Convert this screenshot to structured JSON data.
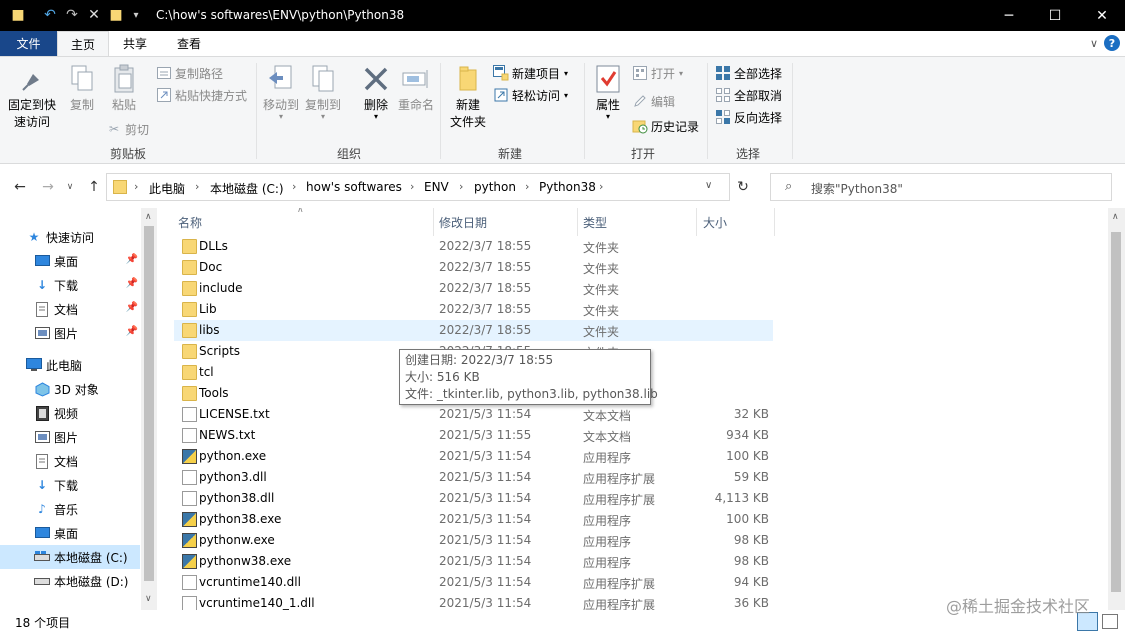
{
  "window": {
    "title": "C:\\how's softwares\\ENV\\python\\Python38",
    "minimize": "─",
    "maximize": "☐",
    "close": "✕"
  },
  "ribbon_tabs": [
    "文件",
    "主页",
    "共享",
    "查看"
  ],
  "ribbon": {
    "clipboard": {
      "label": "剪贴板",
      "pin": "固定到快\n速访问",
      "pin_line1": "固定到快",
      "pin_line2": "速访问",
      "copy": "复制",
      "paste": "粘贴",
      "copy_path": "复制路径",
      "paste_shortcut": "粘贴快捷方式",
      "cut": "剪切"
    },
    "organize": {
      "label": "组织",
      "move_to": "移动到",
      "copy_to": "复制到",
      "delete": "删除",
      "rename": "重命名"
    },
    "new": {
      "label": "新建",
      "new_folder_line1": "新建",
      "new_folder_line2": "文件夹",
      "new_item": "新建项目",
      "easy_access": "轻松访问"
    },
    "open": {
      "label": "打开",
      "properties": "属性",
      "open": "打开",
      "edit": "编辑",
      "history": "历史记录"
    },
    "select": {
      "label": "选择",
      "select_all": "全部选择",
      "select_none": "全部取消",
      "invert": "反向选择"
    }
  },
  "address": {
    "crumbs": [
      "此电脑",
      "本地磁盘 (C:)",
      "how's softwares",
      "ENV",
      "python",
      "Python38"
    ],
    "search_placeholder": "搜索\"Python38\""
  },
  "nav": [
    {
      "label": "快速访问",
      "icon": "star-icon",
      "pinned": false
    },
    {
      "label": "桌面",
      "icon": "desktop-icon",
      "pinned": true
    },
    {
      "label": "下载",
      "icon": "download-icon",
      "pinned": true
    },
    {
      "label": "文档",
      "icon": "document-icon",
      "pinned": true
    },
    {
      "label": "图片",
      "icon": "pictures-icon",
      "pinned": true
    },
    {
      "label": "此电脑",
      "icon": "computer-icon",
      "pinned": false
    },
    {
      "label": "3D 对象",
      "icon": "3d-objects-icon",
      "pinned": false
    },
    {
      "label": "视频",
      "icon": "video-icon",
      "pinned": false
    },
    {
      "label": "图片",
      "icon": "pictures-icon",
      "pinned": false
    },
    {
      "label": "文档",
      "icon": "document-icon",
      "pinned": false
    },
    {
      "label": "下载",
      "icon": "download-icon",
      "pinned": false
    },
    {
      "label": "音乐",
      "icon": "music-icon",
      "pinned": false
    },
    {
      "label": "桌面",
      "icon": "desktop-icon",
      "pinned": false
    },
    {
      "label": "本地磁盘 (C:)",
      "icon": "drive-icon",
      "pinned": false,
      "selected": true
    },
    {
      "label": "本地磁盘 (D:)",
      "icon": "drive-icon",
      "pinned": false
    }
  ],
  "columns": {
    "name": "名称",
    "date": "修改日期",
    "type": "类型",
    "size": "大小"
  },
  "files": [
    {
      "name": "DLLs",
      "date": "2022/3/7 18:55",
      "type": "文件夹",
      "size": "",
      "kind": "folder"
    },
    {
      "name": "Doc",
      "date": "2022/3/7 18:55",
      "type": "文件夹",
      "size": "",
      "kind": "folder"
    },
    {
      "name": "include",
      "date": "2022/3/7 18:55",
      "type": "文件夹",
      "size": "",
      "kind": "folder"
    },
    {
      "name": "Lib",
      "date": "2022/3/7 18:55",
      "type": "文件夹",
      "size": "",
      "kind": "folder"
    },
    {
      "name": "libs",
      "date": "2022/3/7 18:55",
      "type": "文件夹",
      "size": "",
      "kind": "folder",
      "hover": true
    },
    {
      "name": "Scripts",
      "date": "2022/3/7 18:55",
      "type": "文件夹",
      "size": "",
      "kind": "folder"
    },
    {
      "name": "tcl",
      "date": "",
      "type": "",
      "size": "",
      "kind": "folder"
    },
    {
      "name": "Tools",
      "date": "",
      "type": "",
      "size": "",
      "kind": "folder"
    },
    {
      "name": "LICENSE.txt",
      "date": "2021/5/3 11:54",
      "type": "文本文档",
      "size": "32 KB",
      "kind": "text"
    },
    {
      "name": "NEWS.txt",
      "date": "2021/5/3 11:55",
      "type": "文本文档",
      "size": "934 KB",
      "kind": "text"
    },
    {
      "name": "python.exe",
      "date": "2021/5/3 11:54",
      "type": "应用程序",
      "size": "100 KB",
      "kind": "exe"
    },
    {
      "name": "python3.dll",
      "date": "2021/5/3 11:54",
      "type": "应用程序扩展",
      "size": "59 KB",
      "kind": "dll"
    },
    {
      "name": "python38.dll",
      "date": "2021/5/3 11:54",
      "type": "应用程序扩展",
      "size": "4,113 KB",
      "kind": "dll"
    },
    {
      "name": "python38.exe",
      "date": "2021/5/3 11:54",
      "type": "应用程序",
      "size": "100 KB",
      "kind": "exe"
    },
    {
      "name": "pythonw.exe",
      "date": "2021/5/3 11:54",
      "type": "应用程序",
      "size": "98 KB",
      "kind": "exe"
    },
    {
      "name": "pythonw38.exe",
      "date": "2021/5/3 11:54",
      "type": "应用程序",
      "size": "98 KB",
      "kind": "exe"
    },
    {
      "name": "vcruntime140.dll",
      "date": "2021/5/3 11:54",
      "type": "应用程序扩展",
      "size": "94 KB",
      "kind": "dll"
    },
    {
      "name": "vcruntime140_1.dll",
      "date": "2021/5/3 11:54",
      "type": "应用程序扩展",
      "size": "36 KB",
      "kind": "dll"
    }
  ],
  "tooltip": {
    "created": "创建日期: 2022/3/7 18:55",
    "size": "大小: 516 KB",
    "files": "文件: _tkinter.lib, python3.lib, python38.lib"
  },
  "status": {
    "count": "18 个项目"
  },
  "watermark": "@稀土掘金技术社区"
}
